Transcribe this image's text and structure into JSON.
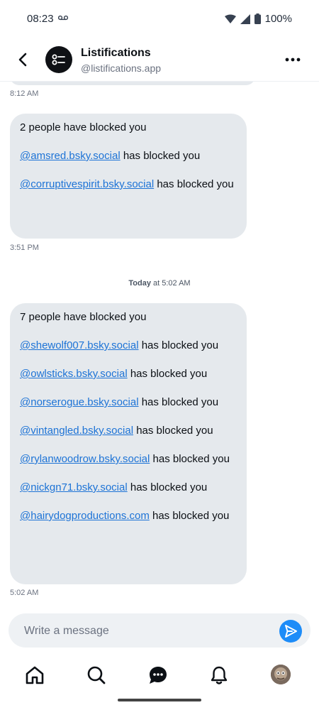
{
  "status_bar": {
    "time": "08:23",
    "battery": "100%"
  },
  "header": {
    "title": "Listifications",
    "handle": "@listifications.app"
  },
  "messages": [
    {
      "time_above": "8:12 AM"
    },
    {
      "lines": [
        {
          "text": "2 people have blocked you"
        },
        {
          "link": "@amsred.bsky.social",
          "suffix": " has blocked you"
        },
        {
          "link": "@corruptivespirit.bsky.social",
          "suffix": " has blocked you"
        }
      ],
      "time": "3:51 PM"
    },
    {
      "day_separator": {
        "day": "Today",
        "at": " at 5:02 AM"
      },
      "lines": [
        {
          "text": "7 people have blocked you"
        },
        {
          "link": "@shewolf007.bsky.social",
          "suffix": " has blocked you"
        },
        {
          "link": "@owlsticks.bsky.social",
          "suffix": " has blocked you"
        },
        {
          "link": "@norserogue.bsky.social",
          "suffix": " has blocked you"
        },
        {
          "link": "@vintangled.bsky.social",
          "suffix": " has blocked you"
        },
        {
          "link": "@rylanwoodrow.bsky.social",
          "suffix": " has blocked you"
        },
        {
          "link": "@nickgn71.bsky.social",
          "suffix": " has blocked you"
        },
        {
          "link": "@hairydogproductions.com",
          "suffix": " has blocked you"
        }
      ],
      "time": "5:02 AM"
    }
  ],
  "composer": {
    "placeholder": "Write a message"
  },
  "icons": {
    "back": "chevron-left-icon",
    "more": "more-horizontal-icon",
    "send": "send-icon",
    "home": "home-icon",
    "search": "search-icon",
    "chat": "chat-icon",
    "notifications": "bell-icon",
    "profile": "profile-avatar"
  },
  "colors": {
    "bubble": "#e5e9ed",
    "link": "#1d73d6",
    "send": "#1d8cf8"
  }
}
